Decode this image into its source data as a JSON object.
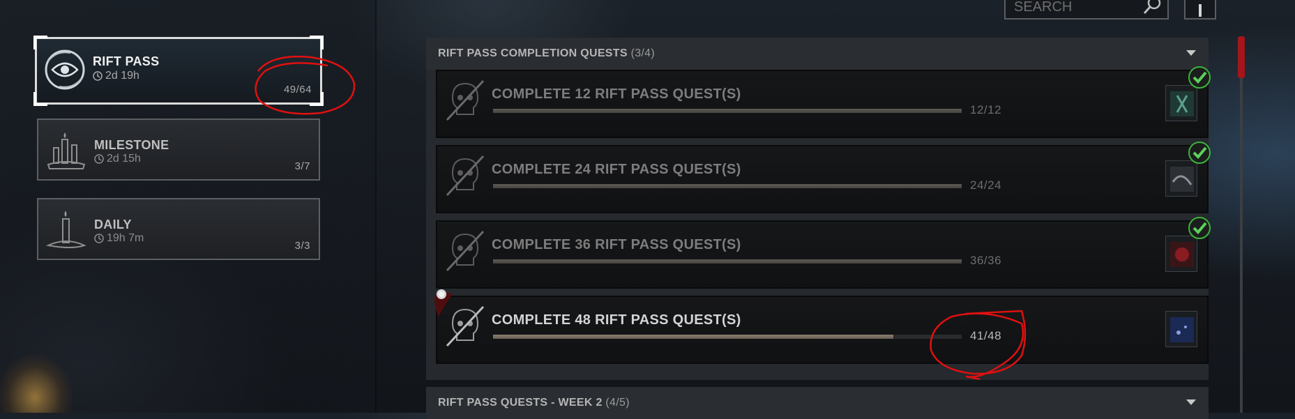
{
  "categories": [
    {
      "title": "RIFT PASS",
      "timer": "2d 19h",
      "count": "49/64",
      "icon": "eye-swirl-icon"
    },
    {
      "title": "MILESTONE",
      "timer": "2d 15h",
      "count": "3/7",
      "icon": "candles-icon"
    },
    {
      "title": "DAILY",
      "timer": "19h 7m",
      "count": "3/3",
      "icon": "candle-icon"
    }
  ],
  "search": {
    "placeholder": "SEARCH"
  },
  "sections": [
    {
      "title": "RIFT PASS COMPLETION QUESTS",
      "count": "(3/4)"
    },
    {
      "title": "RIFT PASS QUESTS - WEEK 2",
      "count": "(4/5)"
    }
  ],
  "quests": [
    {
      "title": "COMPLETE 12 RIFT PASS QUEST(S)",
      "progress": "12/12",
      "fraction": 1.0,
      "completed": true
    },
    {
      "title": "COMPLETE 24 RIFT PASS QUEST(S)",
      "progress": "24/24",
      "fraction": 1.0,
      "completed": true
    },
    {
      "title": "COMPLETE 36 RIFT PASS QUEST(S)",
      "progress": "36/36",
      "fraction": 1.0,
      "completed": true
    },
    {
      "title": "COMPLETE 48 RIFT PASS QUEST(S)",
      "progress": "41/48",
      "fraction": 0.854,
      "completed": false
    }
  ],
  "colors": {
    "accent_red": "#a4161a",
    "check_green": "#3bb53b",
    "annotation_red": "#e01010"
  }
}
